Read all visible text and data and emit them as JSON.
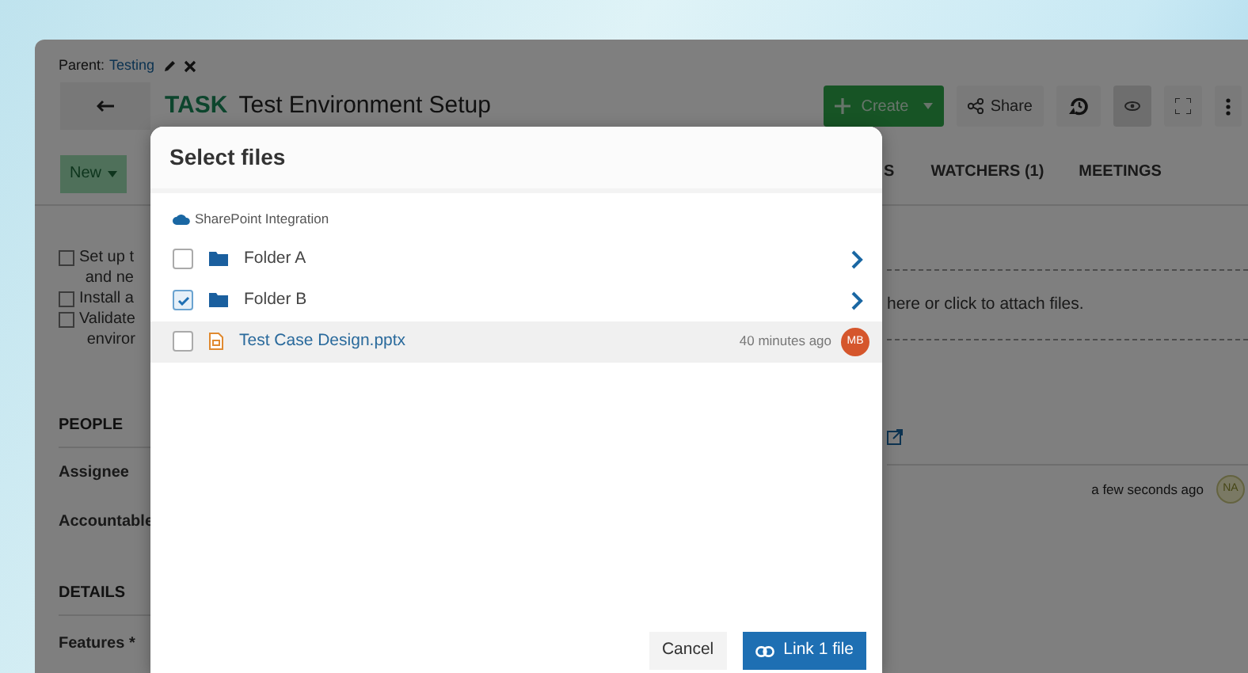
{
  "breadcrumb": {
    "label": "Parent:",
    "link": "Testing"
  },
  "header": {
    "type": "TASK",
    "title": "Test Environment Setup",
    "create": "Create",
    "share": "Share"
  },
  "new_button": "New",
  "tabs": [
    "S",
    "WATCHERS (1)",
    "MEETINGS"
  ],
  "checklist": [
    {
      "lines": [
        "Set up t",
        "and ne"
      ],
      "checked": false
    },
    {
      "lines": [
        "Install a"
      ],
      "checked": false
    },
    {
      "lines": [
        "Validate",
        "enviror"
      ],
      "checked": false
    }
  ],
  "attachments": {
    "drop_text": "here or click to attach files."
  },
  "people": {
    "heading": "PEOPLE",
    "fields": [
      "Assignee",
      "Accountable"
    ]
  },
  "activity": {
    "time": "a few seconds ago",
    "avatar": "NA"
  },
  "details": {
    "heading": "DETAILS",
    "fields": [
      "Features *"
    ]
  },
  "modal": {
    "title": "Select files",
    "source": "SharePoint Integration",
    "items": [
      {
        "kind": "folder",
        "name": "Folder A",
        "checked": false,
        "highlighted": false
      },
      {
        "kind": "folder",
        "name": "Folder B",
        "checked": true,
        "highlighted": false
      },
      {
        "kind": "file",
        "name": "Test Case Design.pptx",
        "checked": false,
        "highlighted": true,
        "time": "40 minutes ago",
        "avatar": "MB",
        "color": "#d5562c"
      }
    ],
    "cancel": "Cancel",
    "confirm": "Link 1 file"
  }
}
